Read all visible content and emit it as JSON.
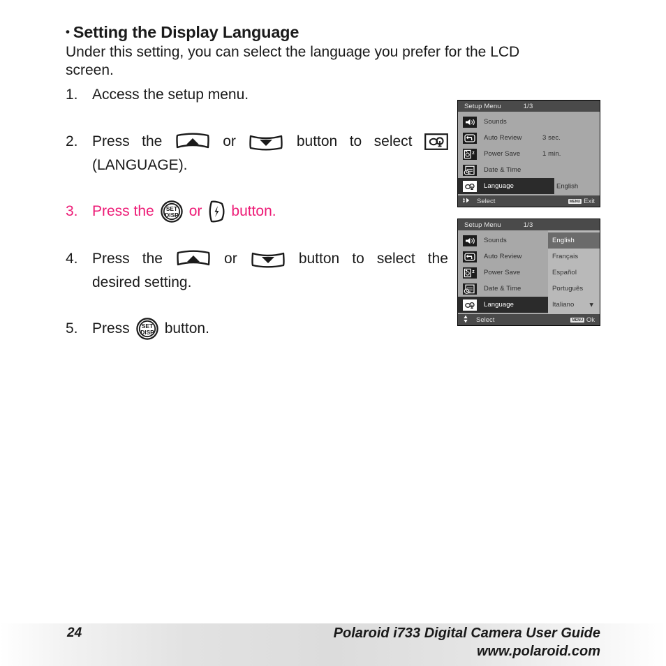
{
  "heading": {
    "bullet": "•",
    "text": "Setting the Display Language"
  },
  "intro": {
    "line1": "Under this setting, you can select the language you prefer for the LCD",
    "line2": "screen."
  },
  "steps": [
    {
      "number": "1.",
      "text": "Access the setup menu."
    },
    {
      "number": "2.",
      "text_a": "Press",
      "text_b": "the",
      "text_c": "or",
      "text_d": "button",
      "text_e": "to",
      "text_f": "select",
      "line2": "(LANGUAGE)."
    },
    {
      "number": "3.",
      "text_a": "Press the",
      "text_b": "or",
      "text_c": "button."
    },
    {
      "number": "4.",
      "text_a": "Press",
      "text_b": "the",
      "text_c": "or",
      "text_d": "button",
      "text_e": "to",
      "text_f": "select",
      "text_g": "the",
      "line2": "desired setting."
    },
    {
      "number": "5.",
      "text_a": "Press",
      "text_b": "button."
    }
  ],
  "colors": {
    "highlight_pink": "#ED1B76",
    "lcd_background": "#a8a8a8",
    "lcd_titlebar": "#4a4a4a",
    "lcd_selected_row": "#2b2b2b",
    "lcd_dropdown_bg": "#b9b9b9",
    "lcd_dropdown_active": "#6b6b6b"
  },
  "lcd_screen_1": {
    "title": "Setup Menu",
    "page_indicator": "1/3",
    "rows": [
      {
        "icon": "speaker-icon",
        "label": "Sounds",
        "value": ""
      },
      {
        "icon": "auto-review-icon",
        "label": "Auto Review",
        "value": "3 sec."
      },
      {
        "icon": "power-save-icon",
        "label": "Power Save",
        "value": "1 min."
      },
      {
        "icon": "date-time-icon",
        "label": "Date & Time",
        "value": ""
      },
      {
        "icon": "language-icon",
        "label": "Language",
        "value": "English"
      }
    ],
    "selected_index": 4,
    "footer_left": "Select",
    "footer_badge": "MENU",
    "footer_right": "Exit"
  },
  "lcd_screen_2": {
    "title": "Setup Menu",
    "page_indicator": "1/3",
    "rows": [
      {
        "icon": "speaker-icon",
        "label": "Sounds",
        "value": ""
      },
      {
        "icon": "auto-review-icon",
        "label": "Auto Review",
        "value": ""
      },
      {
        "icon": "power-save-icon",
        "label": "Power Save",
        "value": ""
      },
      {
        "icon": "date-time-icon",
        "label": "Date & Time",
        "value": ""
      },
      {
        "icon": "language-icon",
        "label": "Language",
        "value": ""
      }
    ],
    "selected_index": 4,
    "language_options": [
      "English",
      "Français",
      "Español",
      "Português",
      "Italiano"
    ],
    "language_selected": "English",
    "scroll_caret": "▼",
    "footer_left": "Select",
    "footer_badge": "MENU",
    "footer_right": "Ok"
  },
  "footer": {
    "page_number": "24",
    "line1": "Polaroid i733 Digital Camera User Guide",
    "line2": "www.polaroid.com"
  }
}
